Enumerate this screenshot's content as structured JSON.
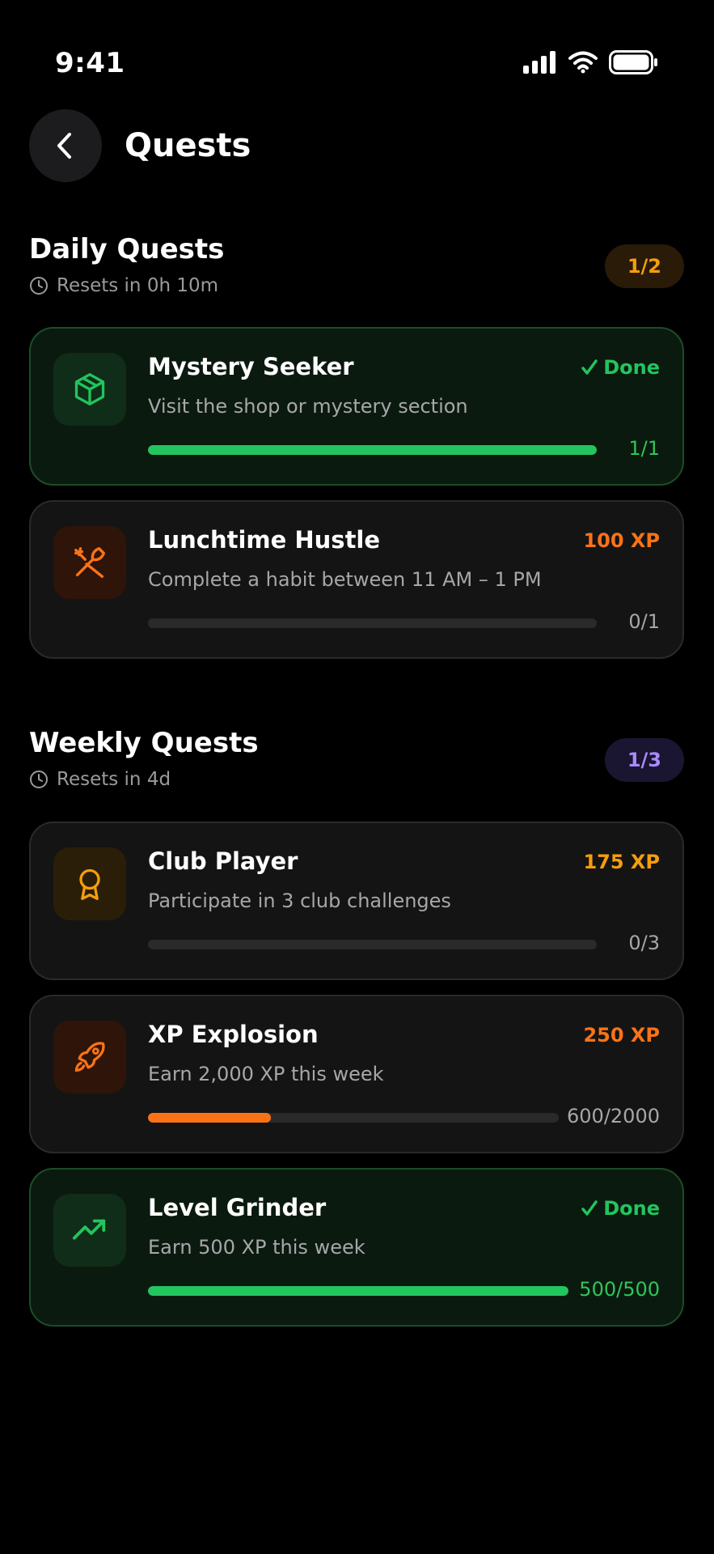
{
  "status": {
    "time": "9:41"
  },
  "header": {
    "title": "Quests"
  },
  "colors": {
    "done": "#22c55e",
    "orange": "#f97316",
    "amber": "#f59e0b",
    "purple": "#a78bfa"
  },
  "daily": {
    "title": "Daily Quests",
    "reset": "Resets in 0h 10m",
    "badge": "1/2",
    "quests": [
      {
        "title": "Mystery Seeker",
        "description": "Visit the shop or mystery section",
        "reward": "Done",
        "progress_label": "1/1",
        "progress": 1.0,
        "icon": "cube-icon",
        "done": true
      },
      {
        "title": "Lunchtime Hustle",
        "description": "Complete a habit between 11 AM – 1 PM",
        "reward": "100 XP",
        "progress_label": "0/1",
        "progress": 0.0,
        "icon": "utensils-icon",
        "done": false
      }
    ]
  },
  "weekly": {
    "title": "Weekly Quests",
    "reset": "Resets in 4d",
    "badge": "1/3",
    "quests": [
      {
        "title": "Club Player",
        "description": "Participate in 3 club challenges",
        "reward": "175 XP",
        "progress_label": "0/3",
        "progress": 0.0,
        "icon": "award-icon",
        "done": false
      },
      {
        "title": "XP Explosion",
        "description": "Earn 2,000 XP this week",
        "reward": "250 XP",
        "progress_label": "600/2000",
        "progress": 0.3,
        "icon": "rocket-icon",
        "done": false
      },
      {
        "title": "Level Grinder",
        "description": "Earn 500 XP this week",
        "reward": "Done",
        "progress_label": "500/500",
        "progress": 1.0,
        "icon": "trending-up-icon",
        "done": true
      }
    ]
  }
}
